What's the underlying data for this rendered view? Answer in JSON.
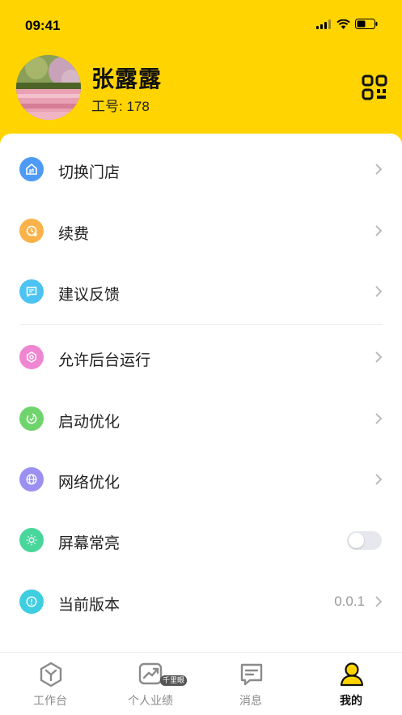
{
  "status_bar": {
    "time": "09:41"
  },
  "profile": {
    "name": "张露露",
    "employee_id": "工号: 178"
  },
  "colors": {
    "brand_yellow": "#FFD400"
  },
  "menu": [
    {
      "label": "切换门店",
      "icon": "store-switch-icon",
      "color": "#4D9BF7"
    },
    {
      "label": "续费",
      "icon": "renew-icon",
      "color": "#FBB24A"
    },
    {
      "label": "建议反馈",
      "icon": "feedback-icon",
      "color": "#4CC3F2"
    },
    {
      "label": "允许后台运行",
      "icon": "background-run-icon",
      "color": "#EF86D2"
    },
    {
      "label": "启动优化",
      "icon": "startup-optimize-icon",
      "color": "#6FD46B"
    },
    {
      "label": "网络优化",
      "icon": "network-optimize-icon",
      "color": "#9B90F2"
    },
    {
      "label": "屏幕常亮",
      "icon": "screen-on-icon",
      "color": "#49D69B",
      "toggle": false
    },
    {
      "label": "当前版本",
      "icon": "version-icon",
      "color": "#3ECEE0",
      "value": "0.0.1"
    }
  ],
  "tabs": [
    {
      "label": "工作台",
      "icon": "workbench-icon",
      "active": false
    },
    {
      "label": "个人业绩",
      "icon": "performance-icon",
      "badge": "千里眼",
      "active": false
    },
    {
      "label": "消息",
      "icon": "message-icon",
      "active": false
    },
    {
      "label": "我的",
      "icon": "profile-icon",
      "active": true
    }
  ]
}
